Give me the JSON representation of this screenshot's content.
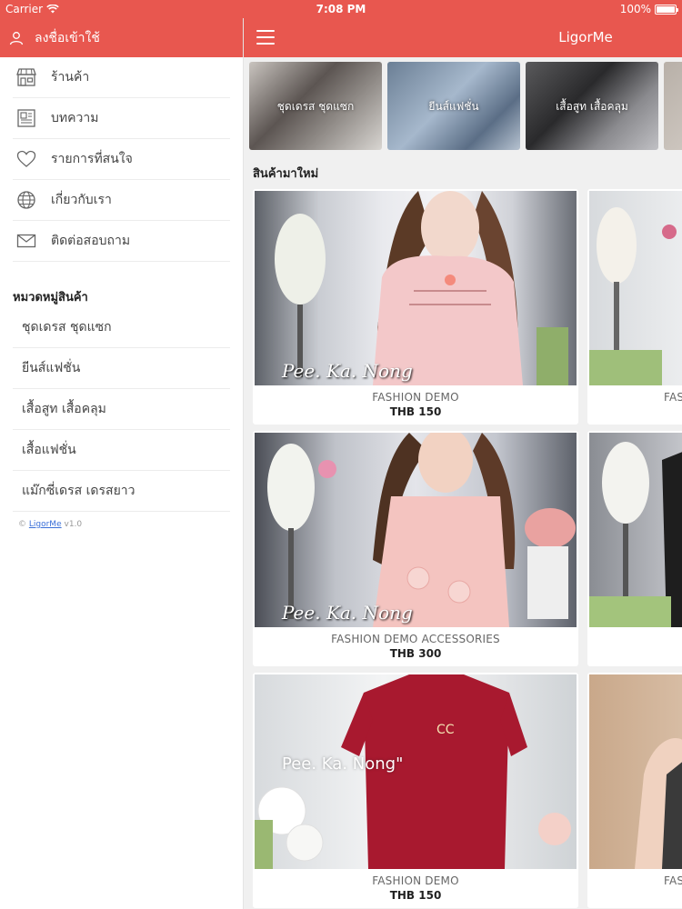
{
  "status_bar": {
    "carrier": "Carrier",
    "time": "7:08 PM",
    "battery_text": "100%",
    "battery_level": 1.0
  },
  "sidebar": {
    "login_label": "ลงชื่อเข้าใช้",
    "menu": [
      {
        "label": "ร้านค้า",
        "icon": "store-icon"
      },
      {
        "label": "บทความ",
        "icon": "newspaper-icon"
      },
      {
        "label": "รายการที่สนใจ",
        "icon": "heart-icon"
      },
      {
        "label": "เกี่ยวกับเรา",
        "icon": "globe-icon"
      },
      {
        "label": "ติดต่อสอบถาม",
        "icon": "envelope-icon"
      }
    ],
    "category_header": "หมวดหมู่สินค้า",
    "categories": [
      "ชุดเดรส ชุดแซก",
      "ยีนส์แฟชั่น",
      "เสื้อสูท เสื้อคลุม",
      "เสื้อแฟชั่น",
      "แม๊กซี่เดรส เดรสยาว"
    ],
    "copyright_symbol": "©",
    "copyright_link": "LigorMe",
    "version": "v1.0"
  },
  "navbar": {
    "title": "LigorMe"
  },
  "category_tiles": [
    {
      "label": "ชุดเดรส ชุดแซก"
    },
    {
      "label": "ยีนส์แฟชั่น"
    },
    {
      "label": "เสื้อสูท เสื้อคลุม"
    },
    {
      "label": ""
    }
  ],
  "section_title": "สินค้ามาใหม่",
  "watermark_text": "Pee. Ka. Nong",
  "watermark_text_alt": "Pee. Ka. Nong\"",
  "products": [
    {
      "name": "FASHION DEMO",
      "price": "THB 150"
    },
    {
      "name": "FAS",
      "price": ""
    },
    {
      "name": "FASHION DEMO ACCESSORIES",
      "price": "THB 300"
    },
    {
      "name": "",
      "price": ""
    },
    {
      "name": "FASHION DEMO",
      "price": "THB 150"
    },
    {
      "name": "FAS",
      "price": ""
    }
  ],
  "colors": {
    "primary": "#e8574f",
    "background": "#f0f0f0",
    "link": "#3a6fd8"
  }
}
